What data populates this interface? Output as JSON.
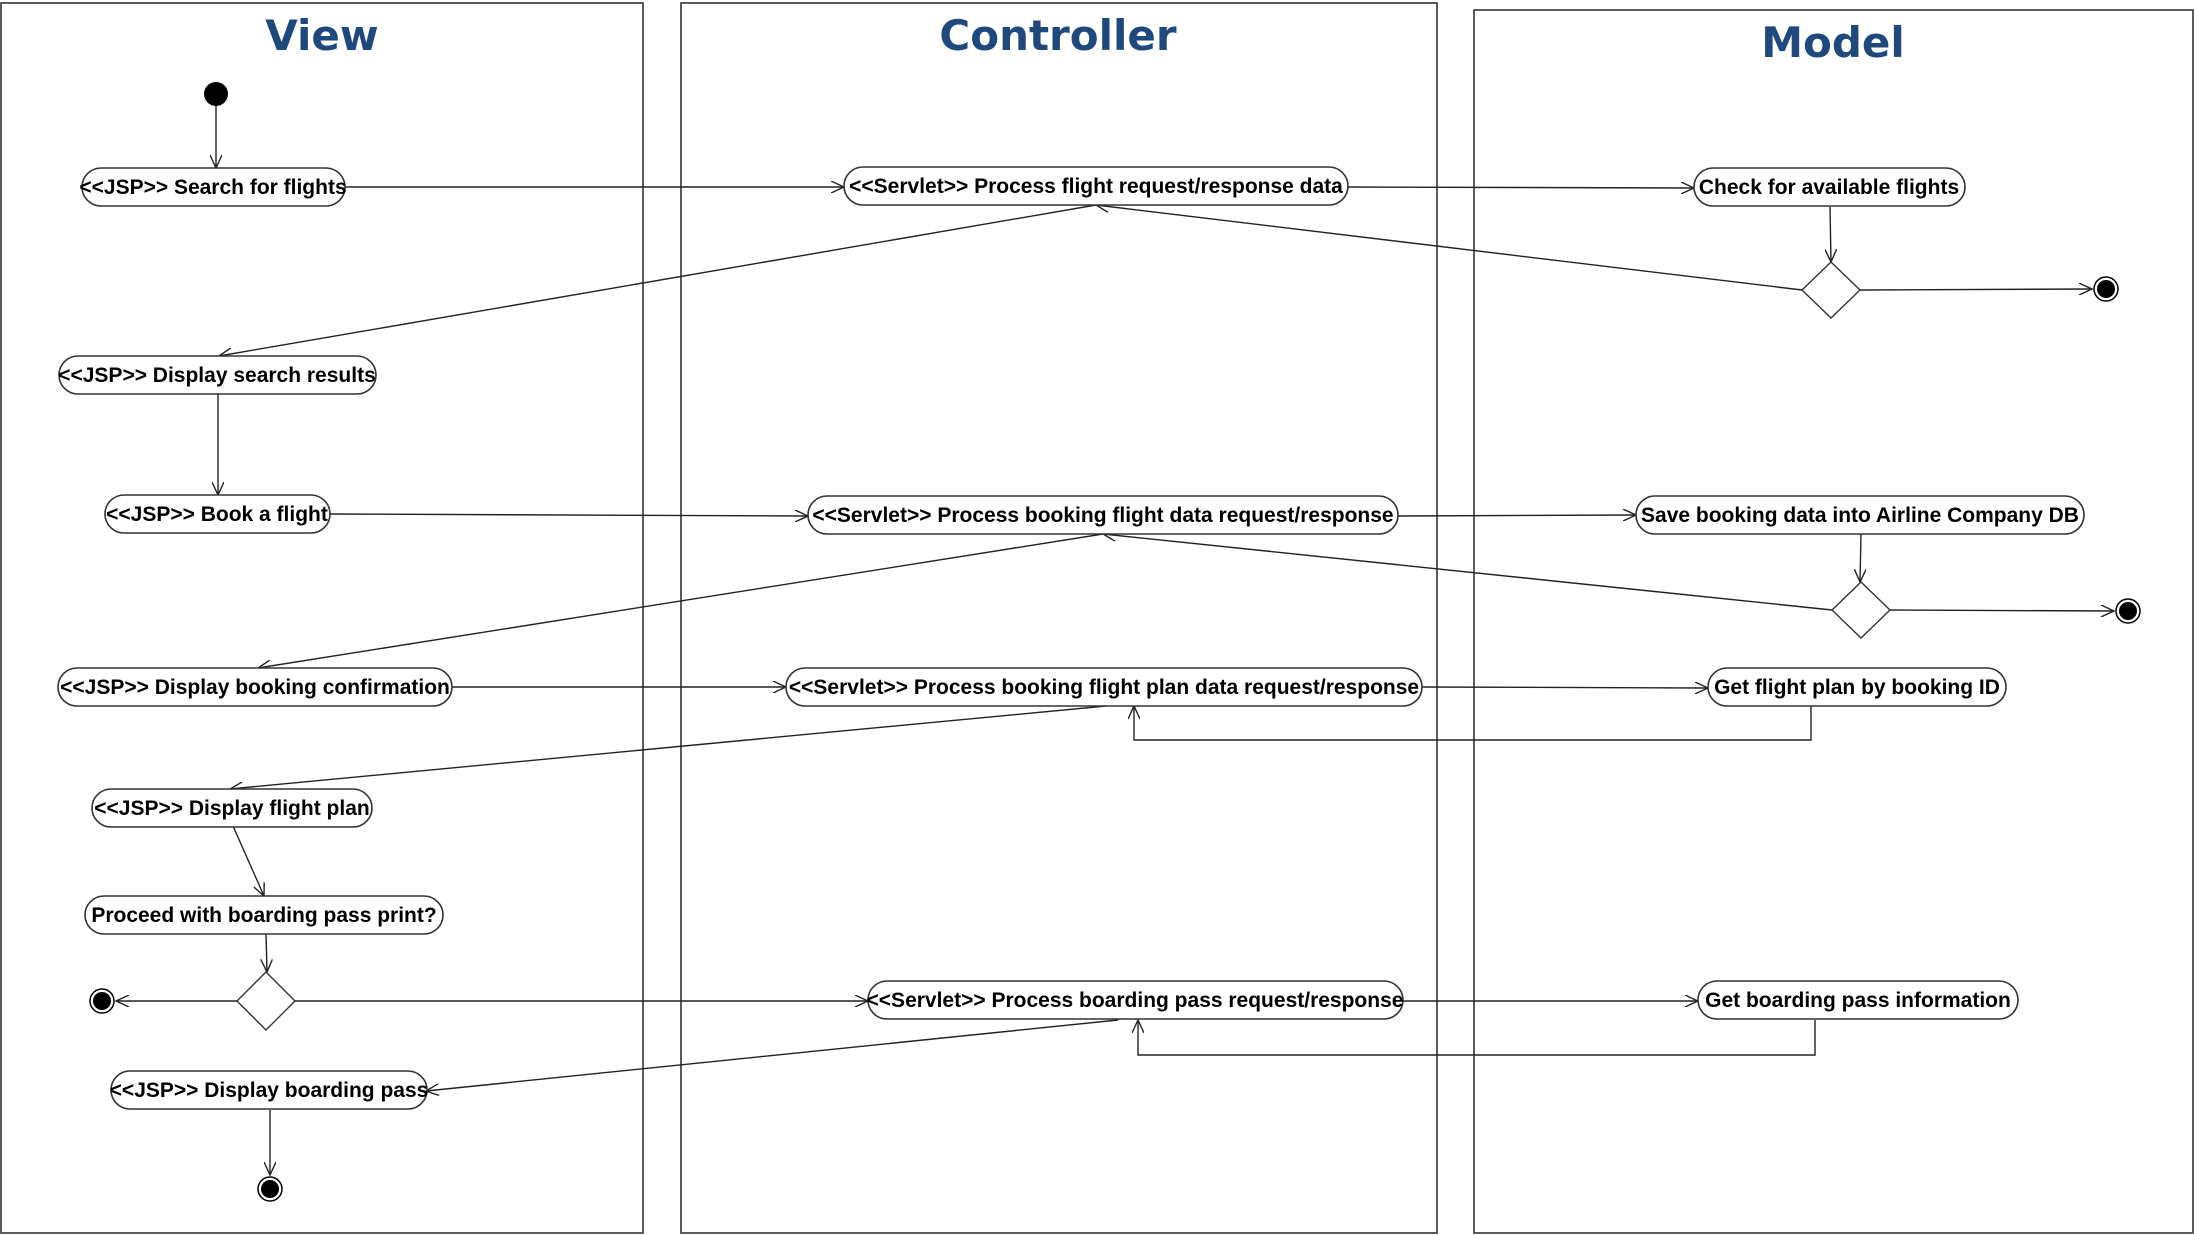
{
  "lanes": {
    "view": "View",
    "controller": "Controller",
    "model": "Model"
  },
  "activities": {
    "search_flights": "<<JSP>> Search for flights",
    "display_search_results": "<<JSP>> Display search results",
    "book_flight": "<<JSP>> Book a flight",
    "display_booking_confirmation": "<<JSP>> Display booking confirmation",
    "display_flight_plan": "<<JSP>> Display flight plan",
    "proceed_boarding_pass": "Proceed with boarding pass print?",
    "display_boarding_pass": "<<JSP>> Display boarding pass",
    "servlet_flight": "<<Servlet>> Process flight request/response data",
    "servlet_booking": "<<Servlet>> Process booking flight data request/response",
    "servlet_flight_plan": "<<Servlet>> Process booking flight plan data request/response",
    "servlet_boarding_pass": "<<Servlet>> Process boarding pass request/response",
    "check_available": "Check for available flights",
    "save_booking": "Save booking data into Airline Company DB",
    "get_flight_plan": "Get flight plan by booking ID",
    "get_boarding_pass": "Get boarding pass information"
  }
}
